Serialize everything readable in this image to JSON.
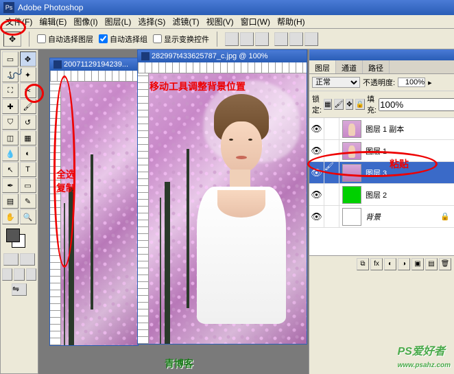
{
  "app_title": "Adobe Photoshop",
  "menu": {
    "file": "文件(F)",
    "edit": "编辑(E)",
    "image": "图像(I)",
    "layer": "图层(L)",
    "select": "选择(S)",
    "filter": "滤镜(T)",
    "view": "视图(V)",
    "window": "窗口(W)",
    "help": "帮助(H)"
  },
  "options": {
    "auto_select_layer": "自动选择图层",
    "auto_select_group": "自动选择组",
    "show_transform": "显示变换控件"
  },
  "docs": {
    "doc1_title": "20071129194239...",
    "doc2_title": "282997t433625787_c.jpg @ 100%"
  },
  "annotations": {
    "select_all": "全选",
    "copy": "复制",
    "move_adjust": "移动工具调整背景位置",
    "paste": "粘贴"
  },
  "panels": {
    "tabs": {
      "layers": "图层",
      "channels": "通道",
      "paths": "路径"
    },
    "blend_mode": "正常",
    "opacity_label": "不透明度:",
    "opacity_value": "100%",
    "lock_label": "锁定:",
    "fill_label": "填充:",
    "fill_value": "100%",
    "layers_list": [
      {
        "name": "图层 1 副本",
        "visible": true,
        "thumb": "portrait"
      },
      {
        "name": "图层 1",
        "visible": true,
        "thumb": "portrait"
      },
      {
        "name": "图层 3",
        "visible": true,
        "thumb": "flowers",
        "selected": true
      },
      {
        "name": "图层 2",
        "visible": true,
        "thumb": "green"
      },
      {
        "name": "背景",
        "visible": true,
        "thumb": "white",
        "italic": true
      }
    ]
  },
  "watermark": "PS爱好者",
  "watermark_url": "www.psahz.com",
  "watermark2": "青博客"
}
